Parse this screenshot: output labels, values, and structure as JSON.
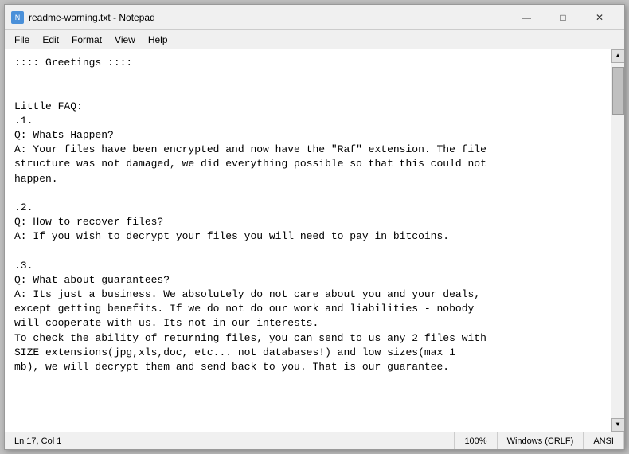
{
  "titlebar": {
    "icon_label": "N",
    "title": "readme-warning.txt - Notepad",
    "minimize_label": "—",
    "maximize_label": "□",
    "close_label": "✕"
  },
  "menubar": {
    "items": [
      "File",
      "Edit",
      "Format",
      "View",
      "Help"
    ]
  },
  "editor": {
    "content": ":::: Greetings ::::\n\n\nLittle FAQ:\n.1.\nQ: Whats Happen?\nA: Your files have been encrypted and now have the \"Raf\" extension. The file\nstructure was not damaged, we did everything possible so that this could not\nhappen.\n\n.2.\nQ: How to recover files?\nA: If you wish to decrypt your files you will need to pay in bitcoins.\n\n.3.\nQ: What about guarantees?\nA: Its just a business. We absolutely do not care about you and your deals,\nexcept getting benefits. If we do not do our work and liabilities - nobody\nwill cooperate with us. Its not in our interests.\nTo check the ability of returning files, you can send to us any 2 files with\nSIZE extensions(jpg,xls,doc, etc... not databases!) and low sizes(max 1\nmb), we will decrypt them and send back to you. That is our guarantee."
  },
  "statusbar": {
    "position": "Ln 17, Col 1",
    "zoom": "100%",
    "line_ending": "Windows (CRLF)",
    "encoding": "ANSI"
  }
}
